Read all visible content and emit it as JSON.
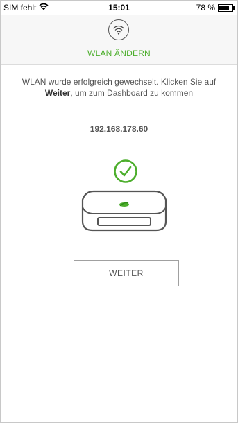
{
  "status_bar": {
    "carrier": "SIM fehlt",
    "time": "15:01",
    "battery": "78 %",
    "battery_level": 0.78
  },
  "header": {
    "icon": "wifi-icon",
    "title": "WLAN ÄNDERN"
  },
  "message": {
    "before": "WLAN wurde erfolgreich gewechselt. Klicken Sie auf ",
    "bold": "Weiter",
    "after": ", um zum Dashboard zu kommen"
  },
  "ip_address": "192.168.178.60",
  "icons": {
    "success": "check-circle-icon",
    "device": "router-device-icon"
  },
  "colors": {
    "accent": "#4cae2c",
    "text": "#555555"
  },
  "buttons": {
    "next": "WEITER"
  }
}
